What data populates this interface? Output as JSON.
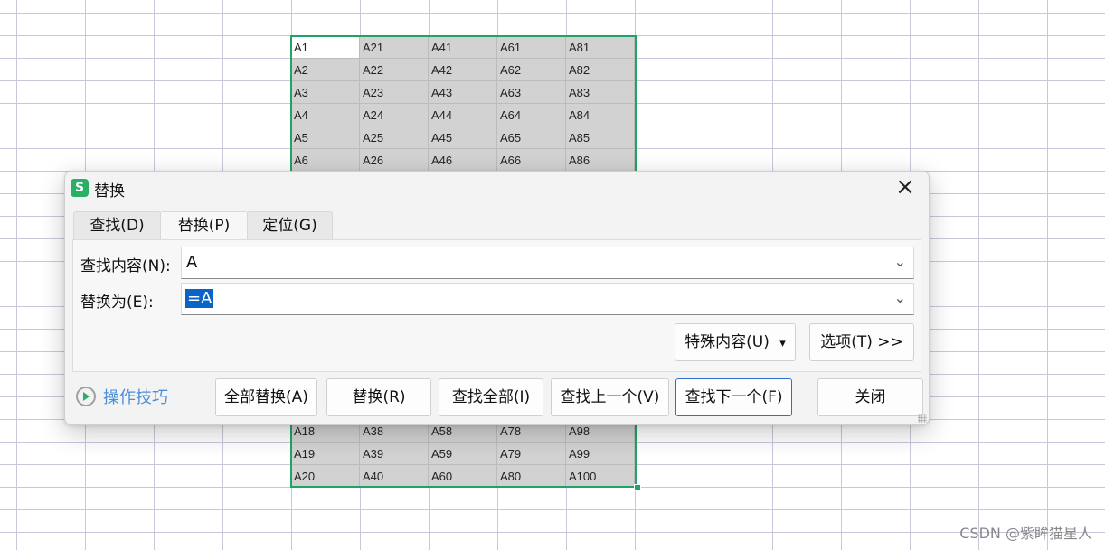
{
  "sheet": {
    "rows_top": [
      [
        "A1",
        "A21",
        "A41",
        "A61",
        "A81"
      ],
      [
        "A2",
        "A22",
        "A42",
        "A62",
        "A82"
      ],
      [
        "A3",
        "A23",
        "A43",
        "A63",
        "A83"
      ],
      [
        "A4",
        "A24",
        "A44",
        "A64",
        "A84"
      ],
      [
        "A5",
        "A25",
        "A45",
        "A65",
        "A85"
      ],
      [
        "A6",
        "A26",
        "A46",
        "A66",
        "A86"
      ]
    ],
    "rows_bottom": [
      [
        "A18",
        "A38",
        "A58",
        "A78",
        "A98"
      ],
      [
        "A19",
        "A39",
        "A59",
        "A79",
        "A99"
      ],
      [
        "A20",
        "A40",
        "A60",
        "A80",
        "A100"
      ]
    ],
    "selection_color": "#21a366"
  },
  "dialog": {
    "app_icon": "S",
    "title": "替换",
    "close_icon": "×",
    "tabs": [
      {
        "label": "查找(D)",
        "active": false
      },
      {
        "label": "替换(P)",
        "active": true
      },
      {
        "label": "定位(G)",
        "active": false
      }
    ],
    "find_label": "查找内容(N):",
    "find_value": "A",
    "replace_label": "替换为(E):",
    "replace_value": "=A",
    "special_button": "特殊内容(U)",
    "special_arrow": "▾",
    "options_button": "选项(T) >>",
    "tips_label": "操作技巧",
    "buttons": {
      "replace_all": "全部替换(A)",
      "replace": "替换(R)",
      "find_all": "查找全部(I)",
      "find_prev": "查找上一个(V)",
      "find_next": "查找下一个(F)",
      "close": "关闭"
    },
    "chevron": "⌄"
  },
  "watermark": "CSDN @紫眸猫星人"
}
